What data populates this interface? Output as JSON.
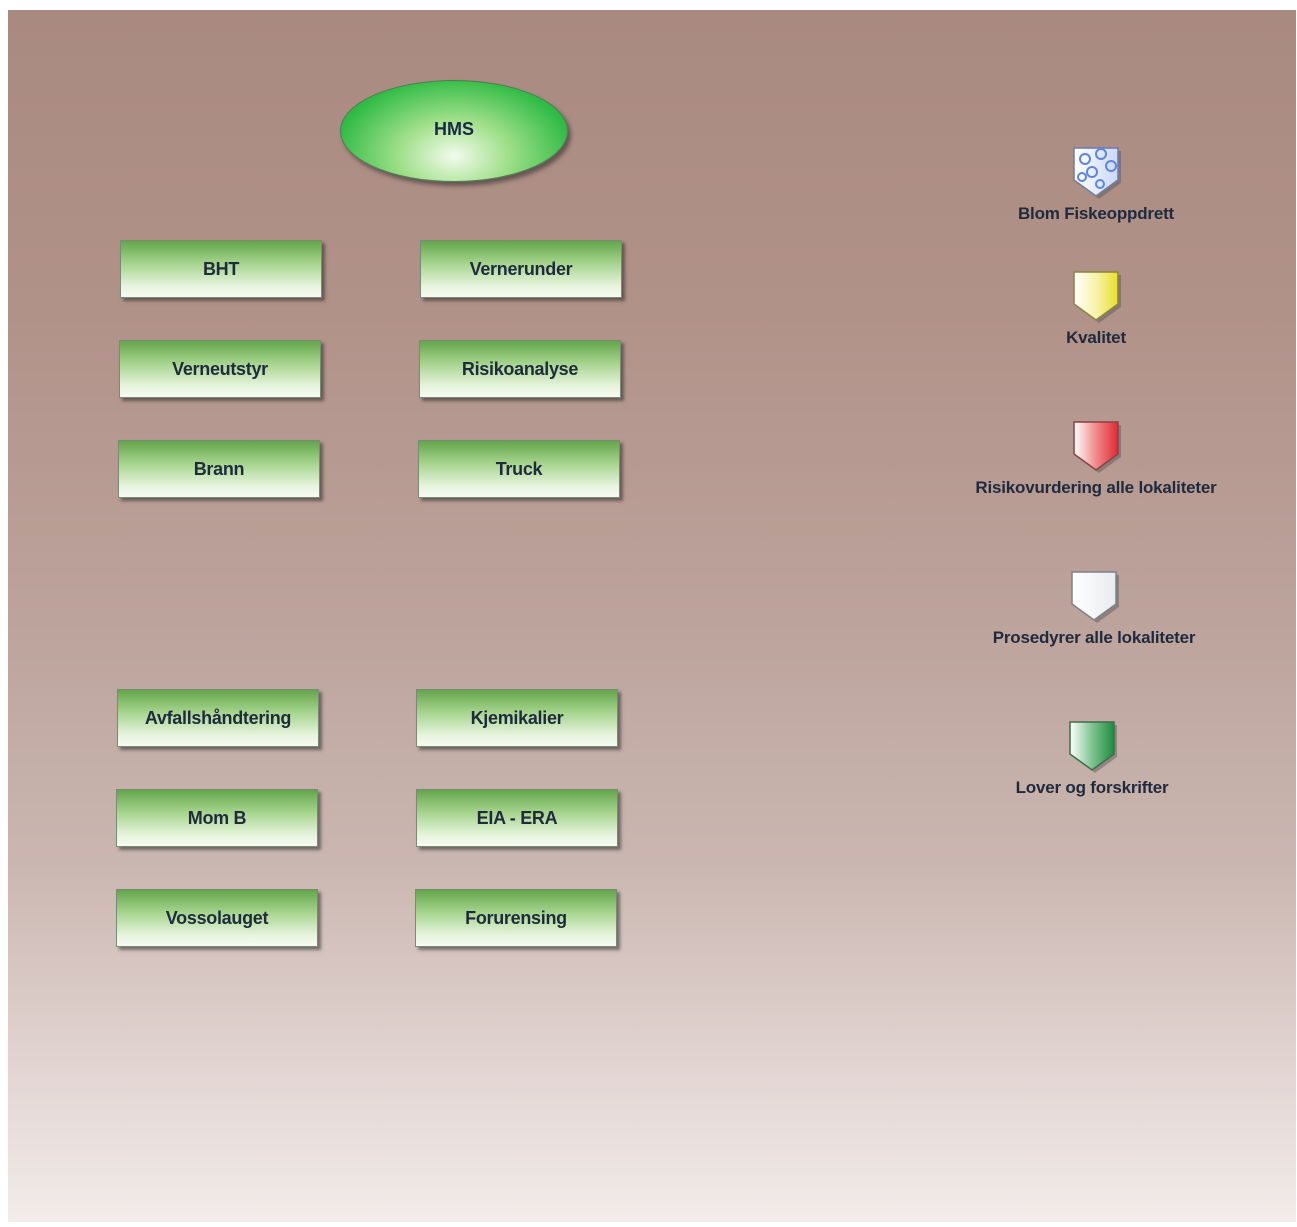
{
  "diagram": {
    "root": {
      "label": "HMS"
    },
    "nodes": [
      {
        "id": "bht",
        "label": "BHT"
      },
      {
        "id": "vernerunder",
        "label": "Vernerunder"
      },
      {
        "id": "verneutstyr",
        "label": "Verneutstyr"
      },
      {
        "id": "risikoanalyse",
        "label": "Risikoanalyse"
      },
      {
        "id": "brann",
        "label": "Brann"
      },
      {
        "id": "truck",
        "label": "Truck"
      },
      {
        "id": "avfallshandtering",
        "label": "Avfallshåndtering"
      },
      {
        "id": "kjemikalier",
        "label": "Kjemikalier"
      },
      {
        "id": "mom-b",
        "label": "Mom B"
      },
      {
        "id": "eia-era",
        "label": "EIA - ERA"
      },
      {
        "id": "vossolauget",
        "label": "Vossolauget"
      },
      {
        "id": "forurensing",
        "label": "Forurensing"
      }
    ]
  },
  "legend": [
    {
      "label": "Blom Fiskeoppdrett",
      "icon": "blue-circles-shield-icon",
      "color": "#9fb8ee"
    },
    {
      "label": "Kvalitet",
      "icon": "yellow-shield-icon",
      "color": "#f0e43a"
    },
    {
      "label": "Risikovurdering alle lokaliteter",
      "icon": "red-shield-icon",
      "color": "#e8363c"
    },
    {
      "label": "Prosedyrer alle lokaliteter",
      "icon": "white-shield-icon",
      "color": "#ffffff"
    },
    {
      "label": "Lover og forskrifter",
      "icon": "green-shield-icon",
      "color": "#2c9a4c"
    }
  ]
}
